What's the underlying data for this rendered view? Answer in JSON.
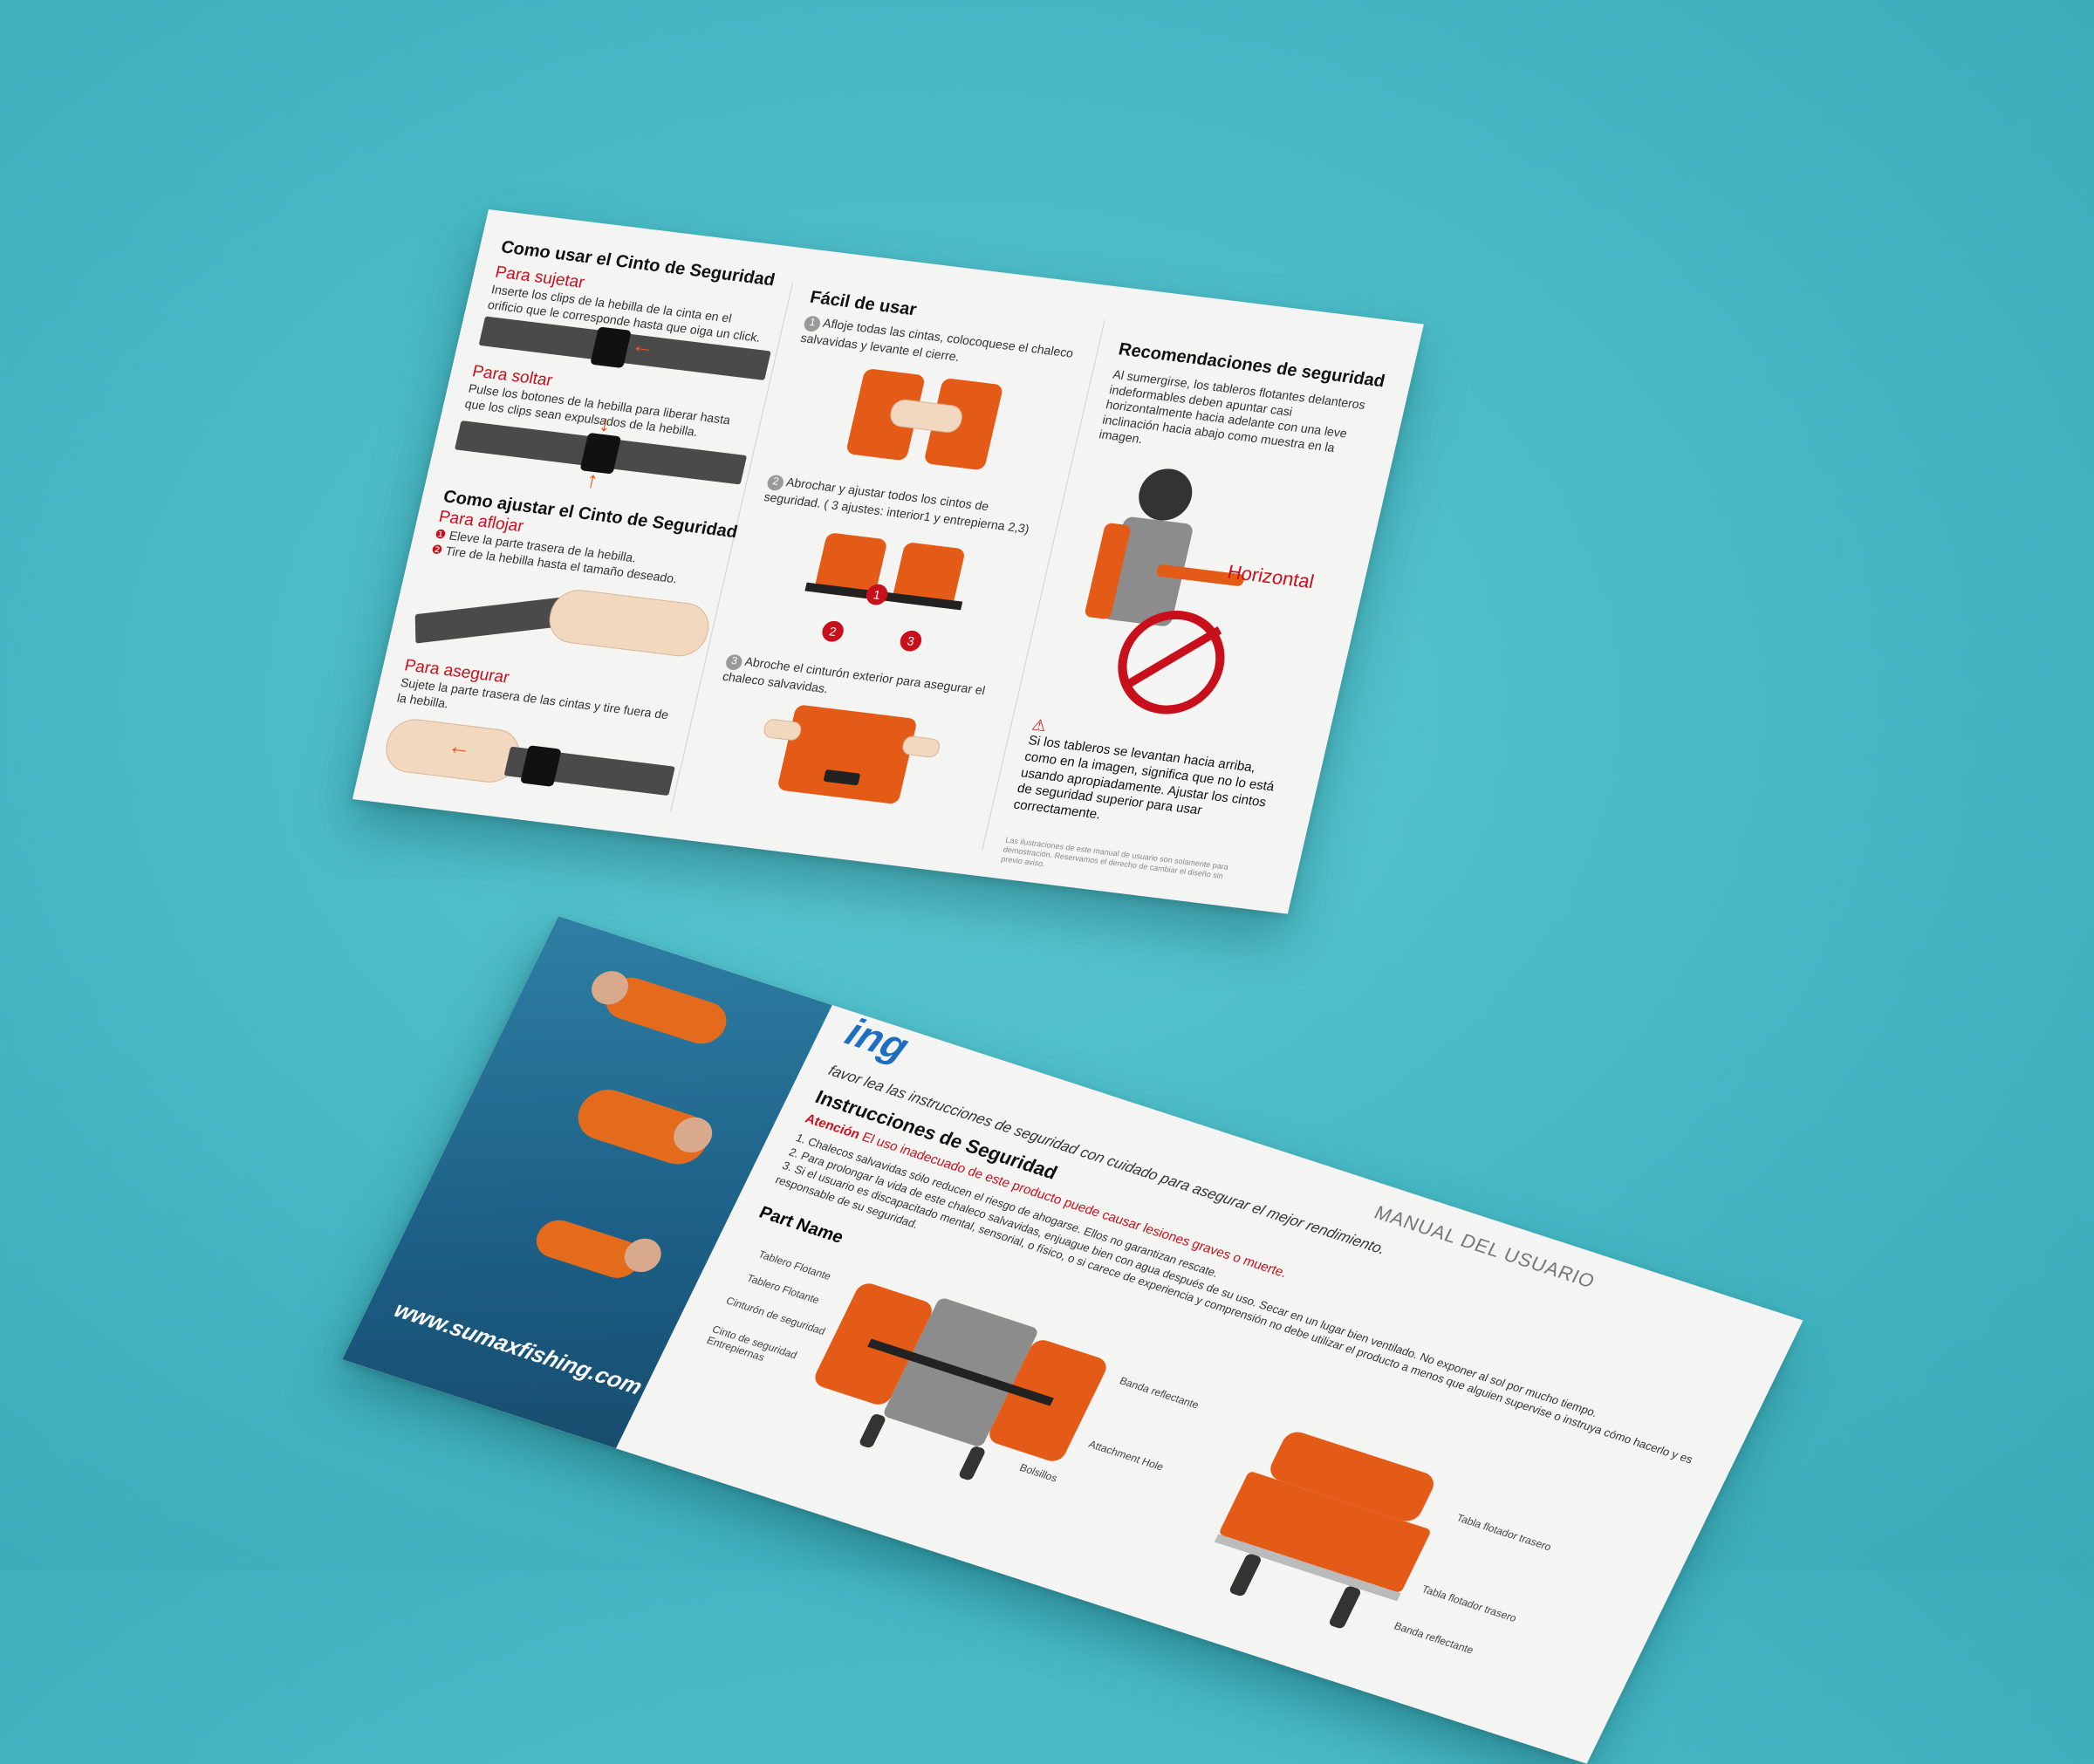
{
  "front": {
    "col1": {
      "title": "Como usar el Cinto de Seguridad",
      "fasten_title": "Para sujetar",
      "fasten_text": "Inserte los clips de la hebilla de la cinta en el orificio que le corresponde hasta que oiga un click.",
      "release_title": "Para soltar",
      "release_text": "Pulse los botones de la hebilla para liberar hasta que los clips sean expulsados de la hebilla.",
      "adjust_title": "Como ajustar el Cinto de Seguridad",
      "loosen_title": "Para aflojar",
      "loosen_step1": "Eleve la parte trasera de la hebilla.",
      "loosen_step2": "Tire de la hebilla hasta el tamaño deseado.",
      "secure_title": "Para asegurar",
      "secure_text": "Sujete la parte trasera de las cintas y tire fuera de la hebilla."
    },
    "col2": {
      "title": "Fácil de usar",
      "step1": "Afloje todas las cintas, colocoquese el chaleco salvavidas y levante el cierre.",
      "step2": "Abrochar y ajustar todos los cintos de seguridad. ( 3 ajustes: interior1 y entrepierna 2,3)",
      "step3": "Abroche el cinturón exterior para asegurar el chaleco salvavidas.",
      "n1": "1",
      "n2": "2",
      "n3": "3",
      "b1": "1",
      "b2": "2",
      "b3": "3"
    },
    "col3": {
      "title": "Recomendaciones de seguridad",
      "text": "Al sumergirse, los tableros flotantes delanteros indeformables deben apuntar casi horizontalmente hacia adelante con una leve inclinación hacia abajo como muestra en la imagen.",
      "horizontal_label": "Horizontal",
      "warning": "Si los tableros se levantan hacia arriba, como en la imagen, significa que no lo está usando apropiadamente. Ajustar los cintos de seguridad superior para usar correctamente.",
      "footnote": "Las ilustraciones de este manual de usuario son solamente para demostración. Reservamos el derecho de cambiar el diseño sin previo aviso."
    }
  },
  "back": {
    "brand_partial": "ing",
    "manual_label": "MANUAL DEL USUARIO",
    "intro": "favor lea las instrucciones de seguridad con cuidado para asegurar el mejor rendimiento.",
    "safety_title": "Instrucciones de Seguridad",
    "attention": "Atención",
    "attention_text": "El uso inadecuado de este producto puede causar lesiones graves o muerte.",
    "item1": "1. Chalecos salvavidas sólo reducen el riesgo de ahogarse. Ellos no garantizan rescate.",
    "item2": "2. Para prolongar la vida de este chaleco salvavidas, enjuague bien con agua después de su uso. Secar en un lugar bien ventilado. No exponer al sol por mucho tiempo.",
    "item3": "3. Si el usuario es discapacitado mental, sensorial, o físico, o si carece de experiencia y comprensión no debe utilizar el producto a menos que alguien supervise o instruya cómo hacerlo y es responsable de su seguridad.",
    "part_title": "Part Name",
    "labels": {
      "tablero1": "Tablero Flotante",
      "tablero2": "Tablero Flotante",
      "cinturon": "Cinturón de seguridad",
      "cinto": "Cinto de seguridad Entrepiernas",
      "banda1": "Banda reflectante",
      "attachment": "Attachment Hole",
      "bolsillos": "Bolsillos",
      "trasero1": "Tabla flotador trasero",
      "trasero2": "Tabla flotador trasero",
      "banda2": "Banda reflectante"
    },
    "website": "www.sumaxfishing.com"
  },
  "colors": {
    "accent_red": "#c8101c",
    "orange": "#e35b16",
    "brand_blue": "#1e6fc0",
    "background": "#45b8c4"
  }
}
